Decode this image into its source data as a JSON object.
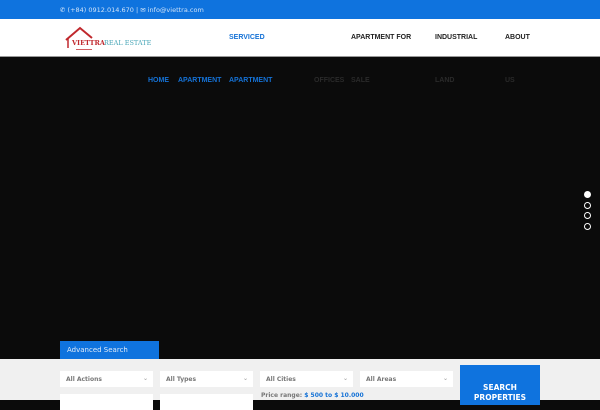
{
  "topbar": {
    "phone": "(+84) 0912.014.670",
    "email": "info@viettra.com"
  },
  "logo": {
    "name": "VIETTRA",
    "suffix": "REAL ESTATE"
  },
  "nav": {
    "home": "HOME",
    "apt1": "APARTMENT",
    "apt2": "APARTMENT",
    "serviced": "SERVICED",
    "offices": "OFFICES",
    "apt_for": "APARTMENT FOR",
    "sale": "SALE",
    "industrial": "INDUSTRIAL",
    "land": "LAND",
    "about": "ABOUT",
    "us": "US"
  },
  "search": {
    "tab": "Advanced Search",
    "actions": "All Actions",
    "types": "All Types",
    "cities": "All Cities",
    "areas": "All Areas",
    "price_label": "Price range:",
    "price_value": "$ 500 to $ 10.000",
    "button": "SEARCH PROPERTIES"
  },
  "slider": {
    "count": 4,
    "active": 0
  }
}
